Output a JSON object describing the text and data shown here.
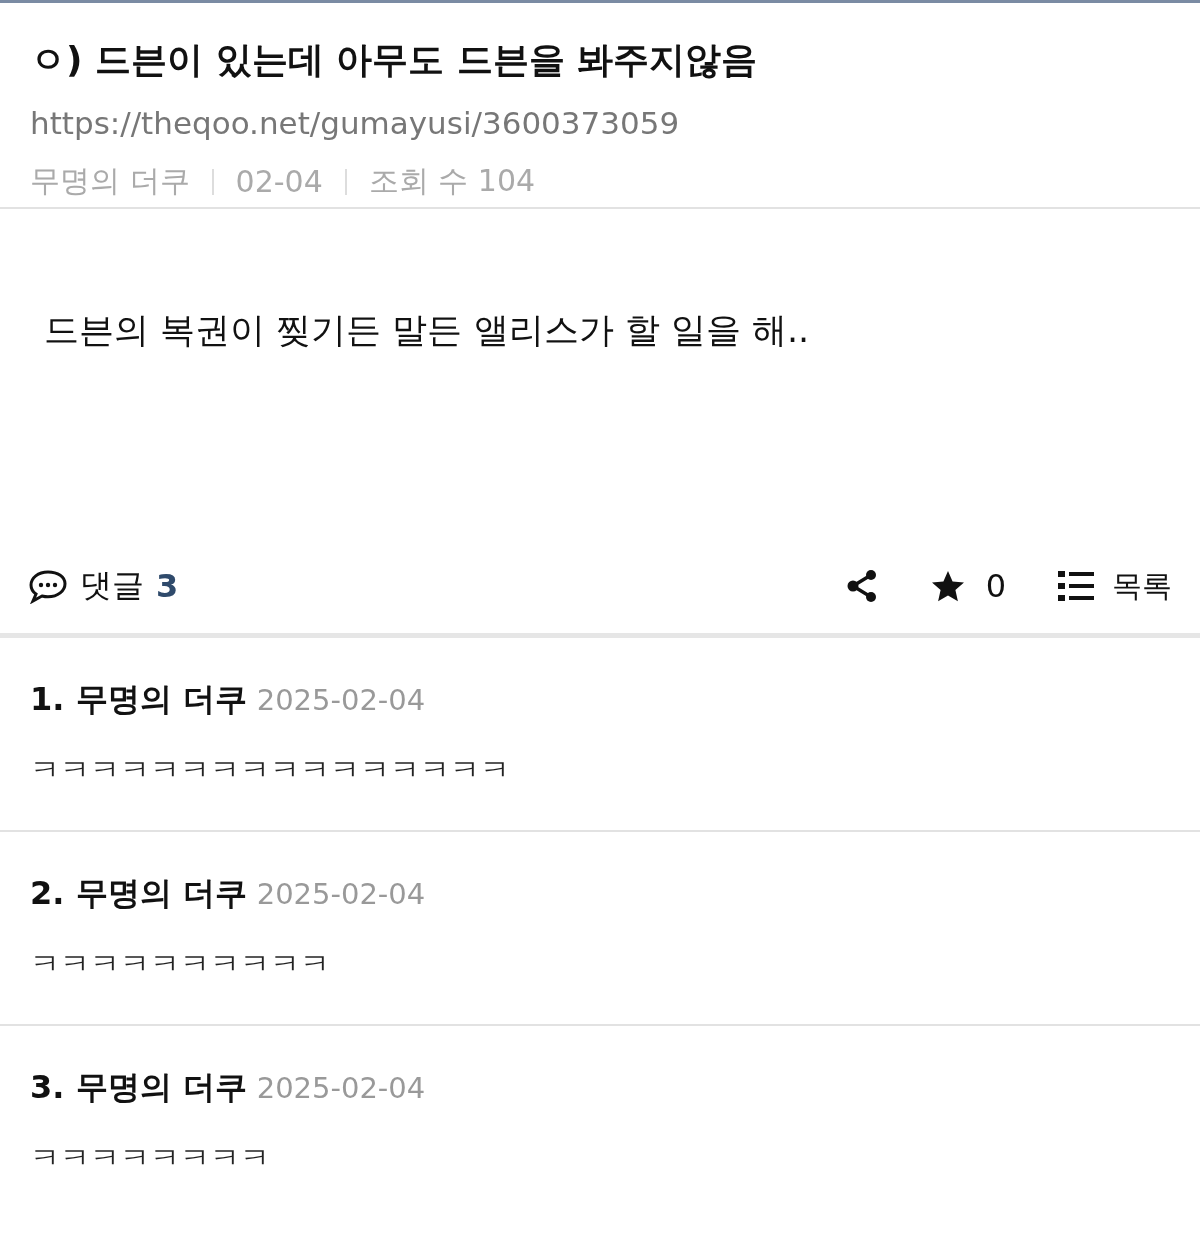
{
  "post": {
    "title": "ㅇ) 드븐이 있는데 아무도 드븐을 봐주지않음",
    "url": "https://theqoo.net/gumayusi/3600373059",
    "meta": [
      "무명의 더쿠",
      "02-04",
      "조회 수 104"
    ],
    "body": "드븐의 복권이 찢기든 말든 앨리스가 할 일을 해.."
  },
  "actions": {
    "comments_label": "댓글",
    "comments_count": "3",
    "star_count": "0",
    "list_label": "목록"
  },
  "comments": [
    {
      "number": "1.",
      "author": "무명의 더쿠",
      "date": "2025-02-04",
      "text": "ㅋㅋㅋㅋㅋㅋㅋㅋㅋㅋㅋㅋㅋㅋㅋㅋ"
    },
    {
      "number": "2.",
      "author": "무명의 더쿠",
      "date": "2025-02-04",
      "text": "ㅋㅋㅋㅋㅋㅋㅋㅋㅋㅋ"
    },
    {
      "number": "3.",
      "author": "무명의 더쿠",
      "date": "2025-02-04",
      "text": "ㅋㅋㅋㅋㅋㅋㅋㅋ"
    }
  ]
}
